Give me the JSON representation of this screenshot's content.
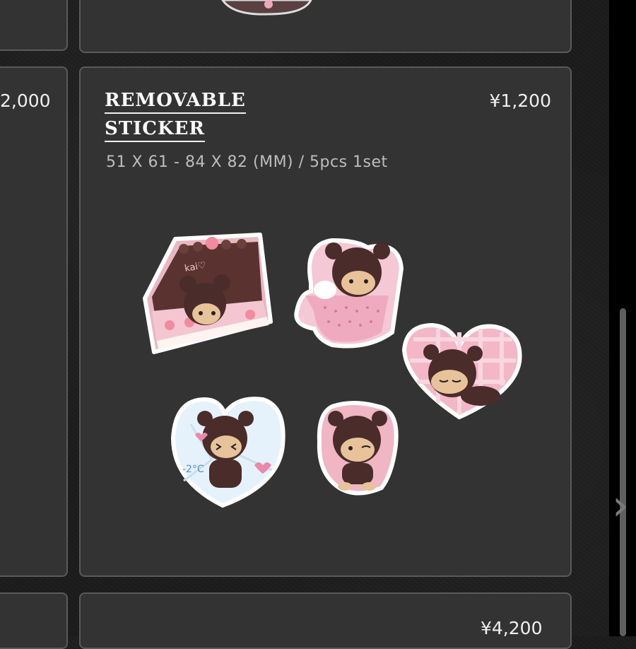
{
  "left_card": {
    "price_partial": "2,000"
  },
  "product": {
    "title_line1": "REMOVABLE",
    "title_line2": "STICKER",
    "price": "¥1,200",
    "spec": "51 X 61 - 84 X 82 (MM) / 5pcs 1set",
    "sticker_text_cake": "kai♡",
    "sticker_text_cold": "-2°C",
    "stickers": [
      "cake-bear-sticker",
      "teacup-bear-sticker",
      "heart-sleeping-bear-sticker",
      "ice-heart-bear-sticker",
      "winking-bear-sticker"
    ]
  },
  "next_card": {
    "price": "¥4,200"
  },
  "colors": {
    "background": "#1b1b1b",
    "card": "#333333",
    "card_border": "#5a5a5a",
    "bear_brown": "#4a2c2a",
    "pink": "#f2b8c6"
  },
  "icons": {
    "next": "chevron-right-icon"
  }
}
